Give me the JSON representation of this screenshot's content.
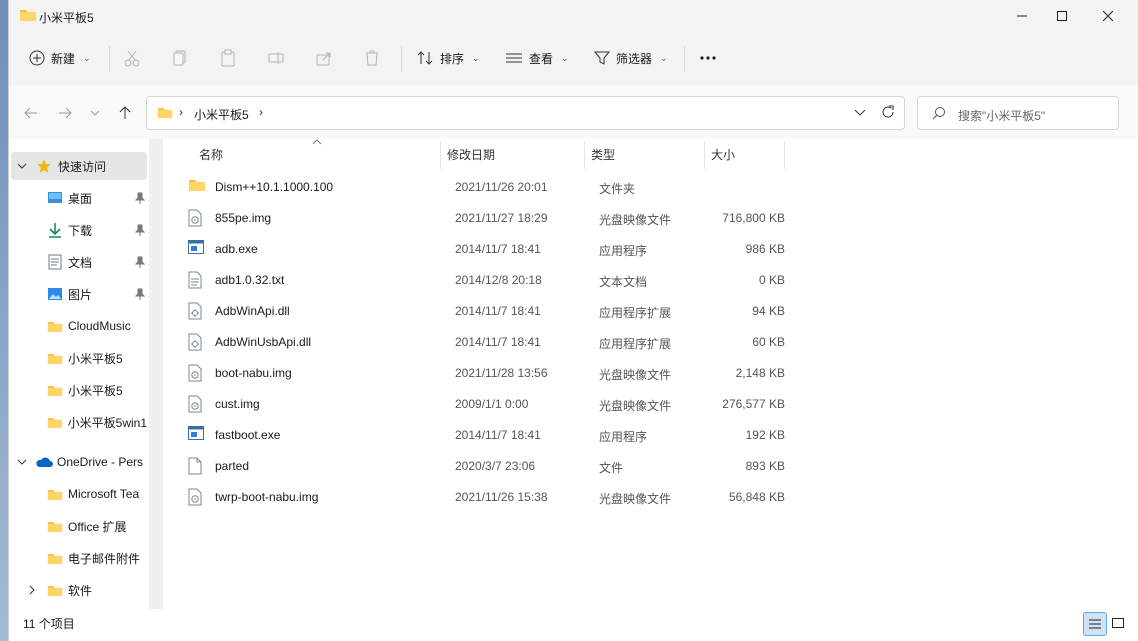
{
  "window": {
    "title": "小米平板5"
  },
  "toolbar": {
    "new_label": "新建",
    "sort_label": "排序",
    "view_label": "查看",
    "filter_label": "筛选器"
  },
  "address": {
    "crumb": "小米平板5",
    "search_placeholder": "搜索\"小米平板5\""
  },
  "sidebar": {
    "items": [
      {
        "label": "快速访问"
      },
      {
        "label": "桌面"
      },
      {
        "label": "下载"
      },
      {
        "label": "文档"
      },
      {
        "label": "图片"
      },
      {
        "label": "CloudMusic"
      },
      {
        "label": "小米平板5"
      },
      {
        "label": "小米平板5"
      },
      {
        "label": "小米平板5win1"
      },
      {
        "label": "OneDrive - Pers"
      },
      {
        "label": "Microsoft Tea"
      },
      {
        "label": "Office 扩展"
      },
      {
        "label": "电子邮件附件"
      },
      {
        "label": "软件"
      }
    ]
  },
  "columns": {
    "name": "名称",
    "modified": "修改日期",
    "type": "类型",
    "size": "大小"
  },
  "files": [
    {
      "name": "Dism++10.1.1000.100",
      "modified": "2021/11/26 20:01",
      "type": "文件夹",
      "size": "",
      "icon": "folder-icon"
    },
    {
      "name": "855pe.img",
      "modified": "2021/11/27 18:29",
      "type": "光盘映像文件",
      "size": "716,800 KB",
      "icon": "disc-image-icon"
    },
    {
      "name": "adb.exe",
      "modified": "2014/11/7 18:41",
      "type": "应用程序",
      "size": "986 KB",
      "icon": "application-icon"
    },
    {
      "name": "adb1.0.32.txt",
      "modified": "2014/12/8 20:18",
      "type": "文本文档",
      "size": "0 KB",
      "icon": "text-file-icon"
    },
    {
      "name": "AdbWinApi.dll",
      "modified": "2014/11/7 18:41",
      "type": "应用程序扩展",
      "size": "94 KB",
      "icon": "dll-icon"
    },
    {
      "name": "AdbWinUsbApi.dll",
      "modified": "2014/11/7 18:41",
      "type": "应用程序扩展",
      "size": "60 KB",
      "icon": "dll-icon"
    },
    {
      "name": "boot-nabu.img",
      "modified": "2021/11/28 13:56",
      "type": "光盘映像文件",
      "size": "2,148 KB",
      "icon": "disc-image-icon"
    },
    {
      "name": "cust.img",
      "modified": "2009/1/1 0:00",
      "type": "光盘映像文件",
      "size": "276,577 KB",
      "icon": "disc-image-icon"
    },
    {
      "name": "fastboot.exe",
      "modified": "2014/11/7 18:41",
      "type": "应用程序",
      "size": "192 KB",
      "icon": "application-icon"
    },
    {
      "name": "parted",
      "modified": "2020/3/7 23:06",
      "type": "文件",
      "size": "893 KB",
      "icon": "blank-file-icon"
    },
    {
      "name": "twrp-boot-nabu.img",
      "modified": "2021/11/26 15:38",
      "type": "光盘映像文件",
      "size": "56,848 KB",
      "icon": "disc-image-icon"
    }
  ],
  "status": {
    "item_count": "11 个项目"
  },
  "colors": {
    "folder": "#f5c242",
    "accent": "#0067c0",
    "selected": "#e6e6e6"
  }
}
